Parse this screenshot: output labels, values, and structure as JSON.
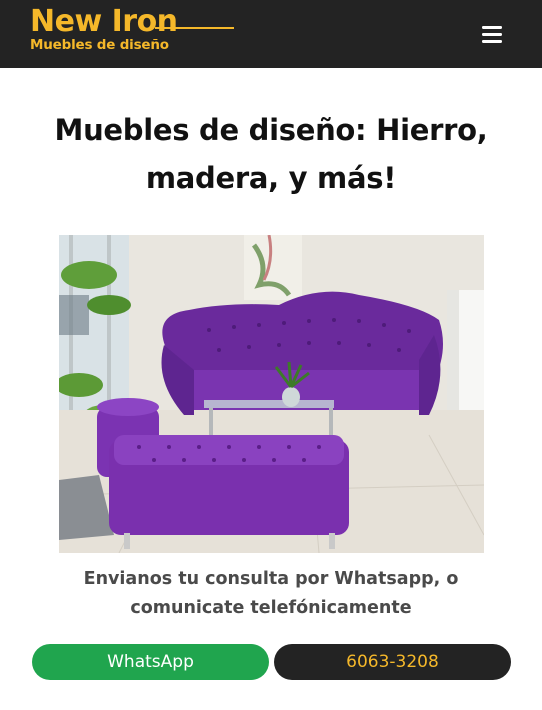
{
  "header": {
    "brand_name": "New Iron",
    "brand_tagline": "Muebles de diseño",
    "menu_icon": "hamburger-menu-icon"
  },
  "main": {
    "title": "Muebles de diseño: Hierro, madera, y más!",
    "photo_description_alt": "",
    "subtitle": "Envianos tu consulta por Whatsapp, o comunicate telefónicamente"
  },
  "actions": {
    "whatsapp_label": "WhatsApp",
    "phone_label": "6063-3208"
  },
  "colors": {
    "header_bg": "#232323",
    "brand_accent": "#f5b82a",
    "whatsapp_green": "#20a54e",
    "title_text": "#111111",
    "subtitle_text": "#4a4a4a"
  }
}
